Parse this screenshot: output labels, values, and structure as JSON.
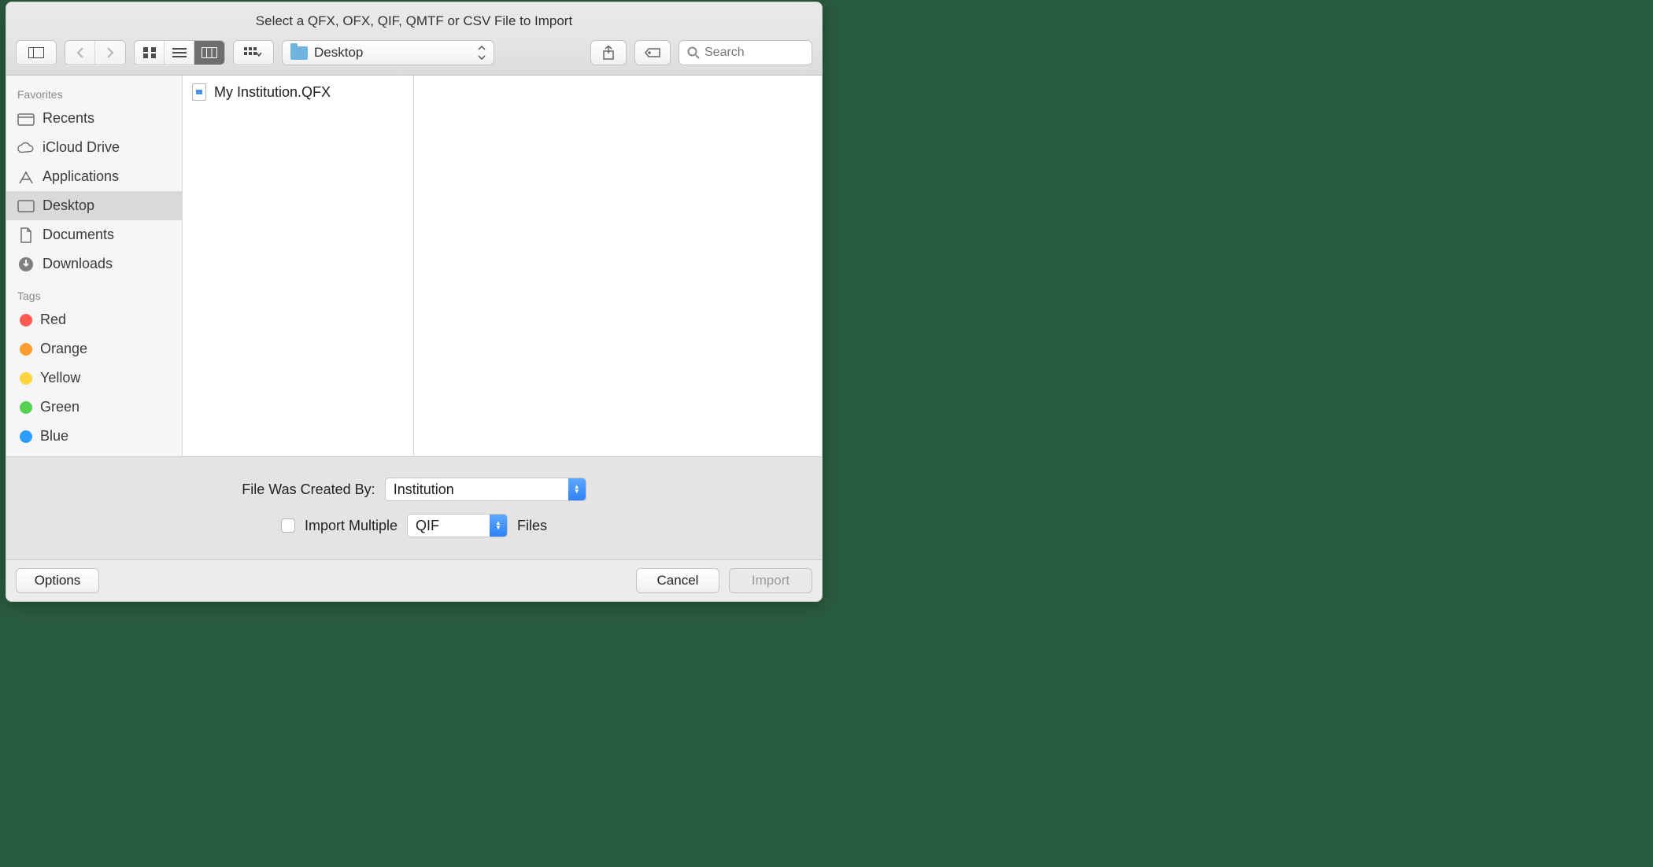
{
  "title": "Select a QFX, OFX, QIF, QMTF or CSV File to Import",
  "toolbar": {
    "path_label": "Desktop",
    "search_placeholder": "Search"
  },
  "sidebar": {
    "headers": {
      "favorites": "Favorites",
      "tags": "Tags"
    },
    "favorites": [
      {
        "label": "Recents",
        "icon": "recents-icon",
        "selected": false
      },
      {
        "label": "iCloud Drive",
        "icon": "cloud-icon",
        "selected": false
      },
      {
        "label": "Applications",
        "icon": "applications-icon",
        "selected": false
      },
      {
        "label": "Desktop",
        "icon": "desktop-icon",
        "selected": true
      },
      {
        "label": "Documents",
        "icon": "documents-icon",
        "selected": false
      },
      {
        "label": "Downloads",
        "icon": "downloads-icon",
        "selected": false
      }
    ],
    "tags": [
      {
        "label": "Red",
        "color": "#ff5b51"
      },
      {
        "label": "Orange",
        "color": "#ff9e2f"
      },
      {
        "label": "Yellow",
        "color": "#ffd53e"
      },
      {
        "label": "Green",
        "color": "#57d152"
      },
      {
        "label": "Blue",
        "color": "#2f9dff"
      }
    ]
  },
  "files": [
    {
      "name": "My Institution.QFX"
    }
  ],
  "options": {
    "created_by_label": "File Was Created By:",
    "created_by_value": "Institution",
    "import_multiple_label": "Import Multiple",
    "import_multiple_checked": false,
    "format_value": "QIF",
    "files_suffix": "Files"
  },
  "footer": {
    "options": "Options",
    "cancel": "Cancel",
    "import": "Import"
  }
}
